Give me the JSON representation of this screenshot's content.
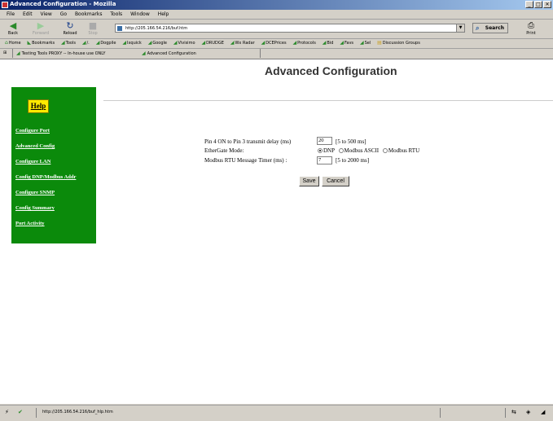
{
  "window": {
    "title": "Advanced Configuration - Mozilla"
  },
  "menu": [
    "File",
    "Edit",
    "View",
    "Go",
    "Bookmarks",
    "Tools",
    "Window",
    "Help"
  ],
  "nav": {
    "back": "Back",
    "forward": "Forward",
    "reload": "Reload",
    "stop": "Stop",
    "url": "http://205.166.54.216/buf.htm",
    "search": "Search",
    "print": "Print"
  },
  "bookmarks": [
    "Home",
    "Bookmarks",
    "Tools",
    "/.",
    "Dogpile",
    "Ixquick",
    "Google",
    "Vivisimo",
    "DRUDGE",
    "Wx Radar",
    "DCEPrices",
    "Protocols",
    "Bid",
    "Favs",
    "Sel",
    "Discussion Groups"
  ],
  "tabs": [
    "Testing Tools PROXY -- In-house use ONLY",
    "Advanced Configuration"
  ],
  "page": {
    "title": "Advanced Configuration",
    "help": "Help",
    "sidebar": [
      "Configure Port",
      "Advanced Config",
      "Configure LAN",
      "Config DNP/Modbus Addr",
      "Configure SNMP",
      "Config Summary",
      "Port Activity"
    ],
    "form": {
      "delay_label": "Pin 4 ON to Pin 3 transmit delay (ms)",
      "delay_value": "20",
      "delay_range": "[5 to 500 ms]",
      "mode_label": "EtherGate Mode:",
      "mode_options": [
        "DNP",
        "Modbus ASCII",
        "Modbus RTU"
      ],
      "mode_selected": "DNP",
      "timer_label": "Modbus RTU Message Timer (ms) :",
      "timer_value": "7",
      "timer_range": "[5 to 2000 ms]",
      "save": "Save",
      "cancel": "Cancel"
    }
  },
  "status": {
    "text": "http://205.166.54.216/buf_hlp.htm"
  }
}
